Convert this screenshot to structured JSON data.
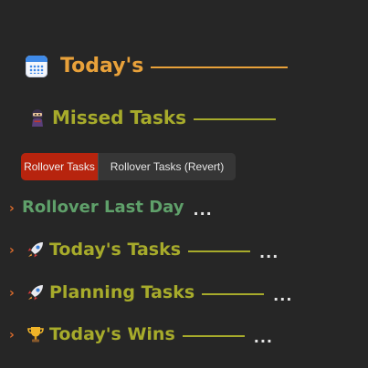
{
  "heading": {
    "title": "Today's",
    "icon": "calendar-icon",
    "color": "#e8a13a"
  },
  "missed": {
    "title": "Missed Tasks",
    "icon": "ninja-icon",
    "color": "#a7ab2b"
  },
  "buttons": {
    "rollover": "Rollover Tasks",
    "rollover_revert": "Rollover Tasks (Revert)",
    "primary_color": "#b7240e"
  },
  "sections": [
    {
      "title": "Rollover Last Day",
      "icon": "",
      "more": "...",
      "color": "#5fa06a"
    },
    {
      "title": "Today's Tasks",
      "icon": "rocket-icon",
      "more": "...",
      "color": "#a7ab2b"
    },
    {
      "title": "Planning Tasks",
      "icon": "rocket-icon",
      "more": "...",
      "color": "#a7ab2b"
    },
    {
      "title": "Today's Wins",
      "icon": "trophy-icon",
      "more": "...",
      "color": "#a7ab2b"
    }
  ],
  "chevron_color": "#d86a2c"
}
